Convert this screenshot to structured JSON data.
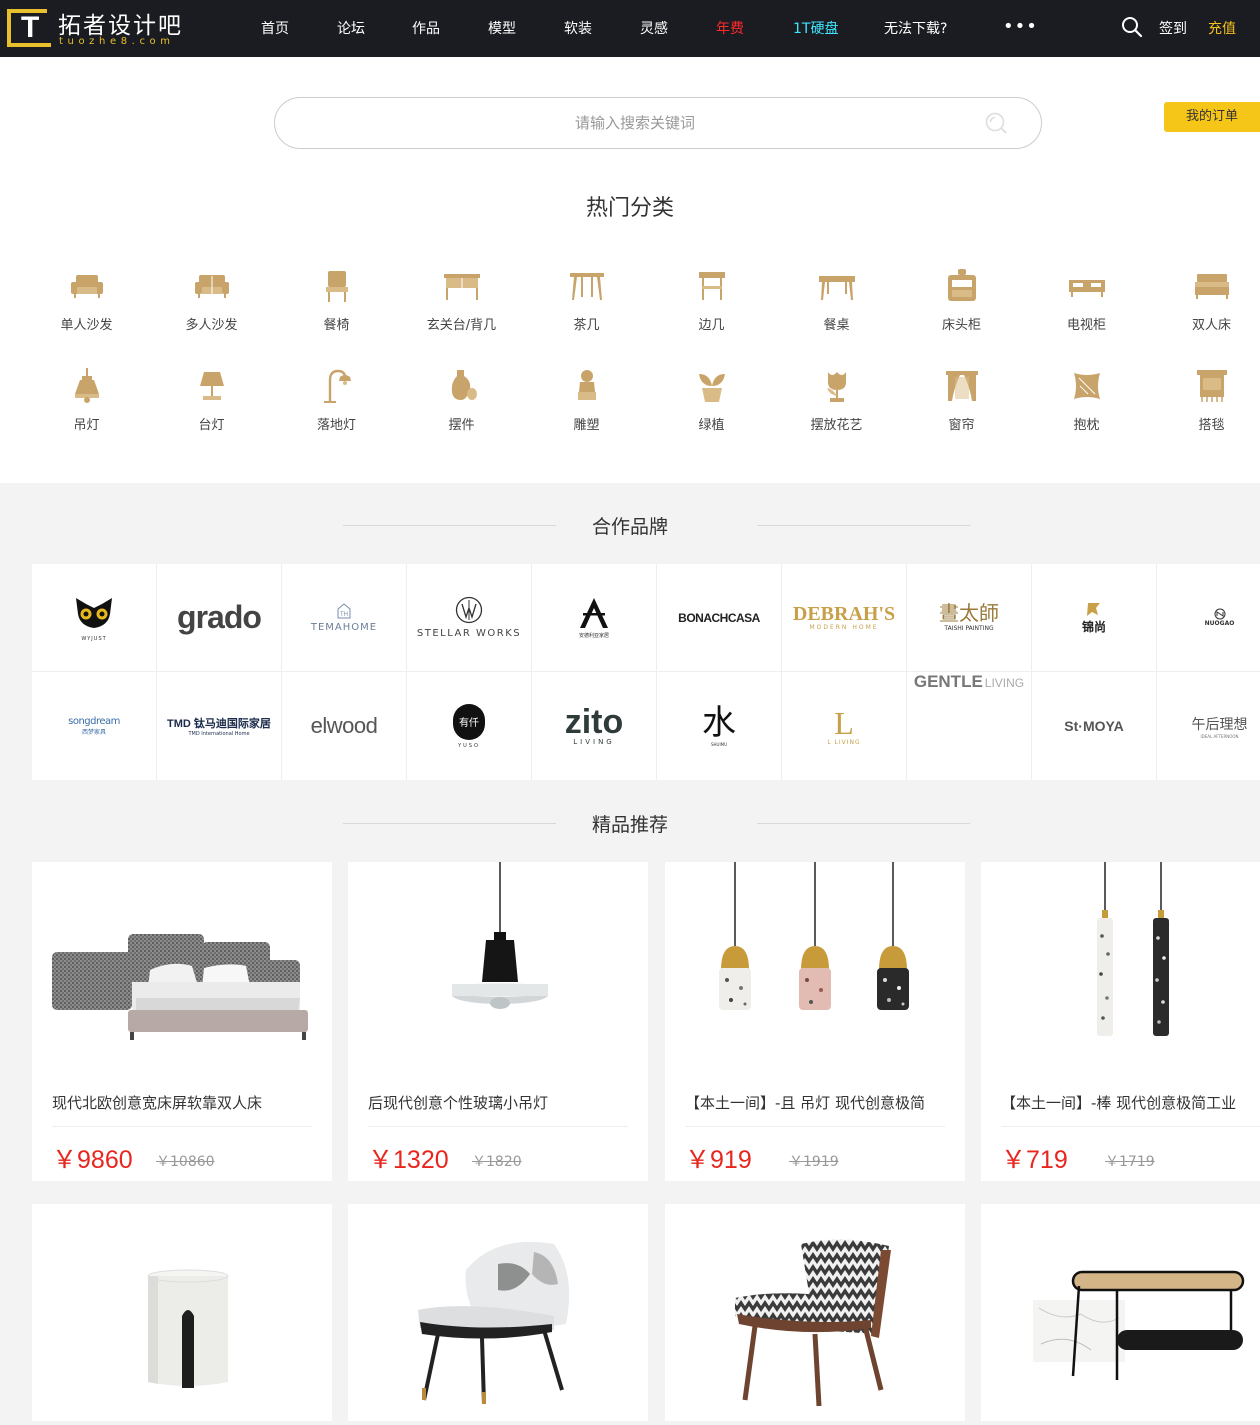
{
  "header": {
    "logo_cn": "拓者设计吧",
    "logo_en": "tuozhe8.com",
    "nav": [
      {
        "label": "首页",
        "style": "normal"
      },
      {
        "label": "论坛",
        "style": "normal"
      },
      {
        "label": "作品",
        "style": "normal"
      },
      {
        "label": "模型",
        "style": "normal"
      },
      {
        "label": "软装",
        "style": "normal"
      },
      {
        "label": "灵感",
        "style": "normal"
      },
      {
        "label": "年费",
        "style": "red"
      },
      {
        "label": "1T硬盘",
        "style": "cyan"
      },
      {
        "label": "无法下载?",
        "style": "normal"
      }
    ],
    "more": "•••",
    "signin": "签到",
    "recharge": "充值"
  },
  "search": {
    "placeholder": "请输入搜索关键词"
  },
  "orders_button": "我的订单",
  "hot_categories": {
    "title": "热门分类",
    "items": [
      {
        "label": "单人沙发",
        "icon": "armchair-icon"
      },
      {
        "label": "多人沙发",
        "icon": "sofa-icon"
      },
      {
        "label": "餐椅",
        "icon": "dining-chair-icon"
      },
      {
        "label": "玄关台/背几",
        "icon": "console-table-icon"
      },
      {
        "label": "茶几",
        "icon": "coffee-table-icon"
      },
      {
        "label": "边几",
        "icon": "side-table-icon"
      },
      {
        "label": "餐桌",
        "icon": "dining-table-icon"
      },
      {
        "label": "床头柜",
        "icon": "nightstand-icon"
      },
      {
        "label": "电视柜",
        "icon": "tv-cabinet-icon"
      },
      {
        "label": "双人床",
        "icon": "double-bed-icon"
      },
      {
        "label": "吊灯",
        "icon": "pendant-lamp-icon"
      },
      {
        "label": "台灯",
        "icon": "table-lamp-icon"
      },
      {
        "label": "落地灯",
        "icon": "floor-lamp-icon"
      },
      {
        "label": "摆件",
        "icon": "vase-ornament-icon"
      },
      {
        "label": "雕塑",
        "icon": "sculpture-icon"
      },
      {
        "label": "绿植",
        "icon": "plant-icon"
      },
      {
        "label": "摆放花艺",
        "icon": "flower-icon"
      },
      {
        "label": "窗帘",
        "icon": "curtain-icon"
      },
      {
        "label": "抱枕",
        "icon": "pillow-icon"
      },
      {
        "label": "搭毯",
        "icon": "blanket-icon"
      }
    ],
    "icon_color": "#c9a46a"
  },
  "brands": {
    "title": "合作品牌",
    "items": [
      {
        "name": "WYJUST",
        "sub": ""
      },
      {
        "name": "grado",
        "sub": ""
      },
      {
        "name": "TEMAHOME",
        "sub": ""
      },
      {
        "name": "STELLAR WORKS",
        "sub": ""
      },
      {
        "name": "安德利亚家居",
        "sub": ""
      },
      {
        "name": "BONACHCASA",
        "sub": ""
      },
      {
        "name": "DEBRAH'S",
        "sub": "MODERN HOME"
      },
      {
        "name": "晝太師",
        "sub": "TAISHI PAINTING"
      },
      {
        "name": "锦尚",
        "sub": ""
      },
      {
        "name": "NUOGAO",
        "sub": ""
      },
      {
        "name": "songdream",
        "sub": "西梦家具"
      },
      {
        "name": "TMD 钛马迪国际家居",
        "sub": "TMD International Home"
      },
      {
        "name": "elwood",
        "sub": ""
      },
      {
        "name": "有仟",
        "sub": "YUSO"
      },
      {
        "name": "zito",
        "sub": "LIVING"
      },
      {
        "name": "水",
        "sub": "SHUIMU"
      },
      {
        "name": "L",
        "sub": "L LIVING"
      },
      {
        "name": "GENTLE",
        "sub": "LIVING"
      },
      {
        "name": "St·MOYA",
        "sub": ""
      },
      {
        "name": "午后理想",
        "sub": "IDEAL AFTERNOON"
      }
    ]
  },
  "recommend": {
    "title": "精品推荐",
    "currency": "￥",
    "products": [
      {
        "name": "现代北欧创意宽床屏软靠双人床",
        "price": "9860",
        "old_price": "10860"
      },
      {
        "name": "后现代创意个性玻璃小吊灯",
        "price": "1320",
        "old_price": "1820"
      },
      {
        "name": "【本土一间】-且 吊灯 现代创意极简",
        "price": "919",
        "old_price": "1919"
      },
      {
        "name": "【本土一间】-棒 现代创意极简工业",
        "price": "719",
        "old_price": "1719"
      }
    ]
  }
}
